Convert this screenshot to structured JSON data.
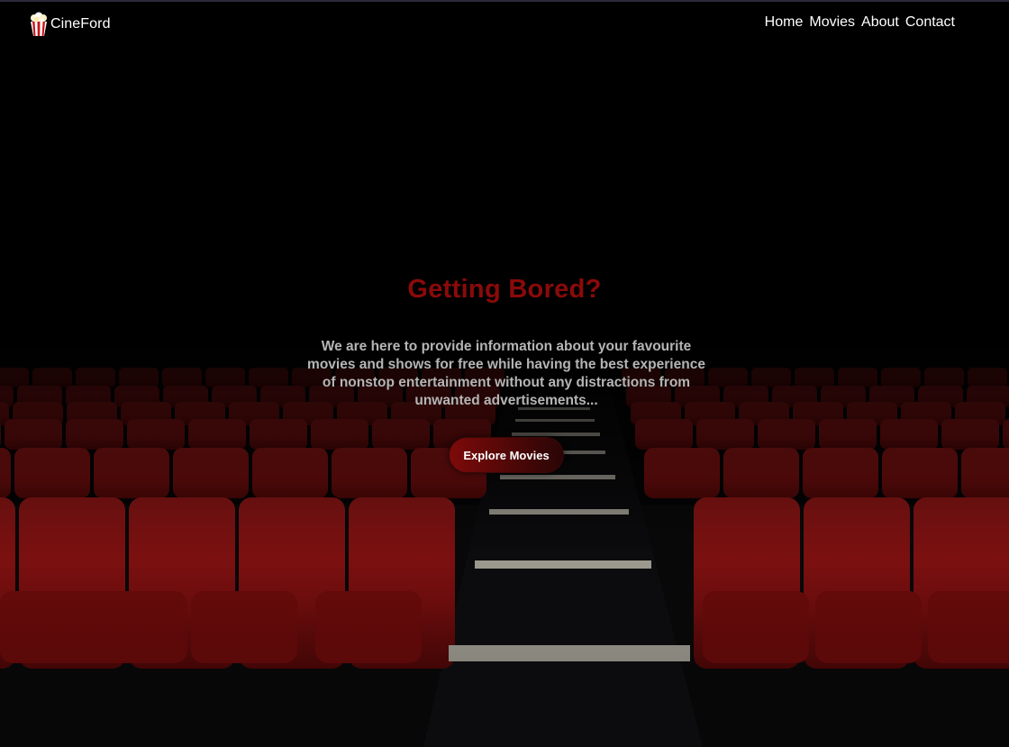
{
  "navbar": {
    "brand_name": "CineFord",
    "links": [
      {
        "label": "Home"
      },
      {
        "label": "Movies"
      },
      {
        "label": "About"
      },
      {
        "label": "Contact"
      }
    ]
  },
  "hero": {
    "title": "Getting Bored?",
    "description": "We are here to provide information about your favourite movies and shows for free while having the best experience of nonstop entertainment without any distractions from unwanted advertisements...",
    "cta_label": "Explore Movies"
  },
  "colors": {
    "title": "#8b0a0a",
    "seat": "#8e1212",
    "button_start": "#7d0a0a",
    "button_end": "#2a0505"
  },
  "icons": {
    "brand": "popcorn-icon"
  }
}
